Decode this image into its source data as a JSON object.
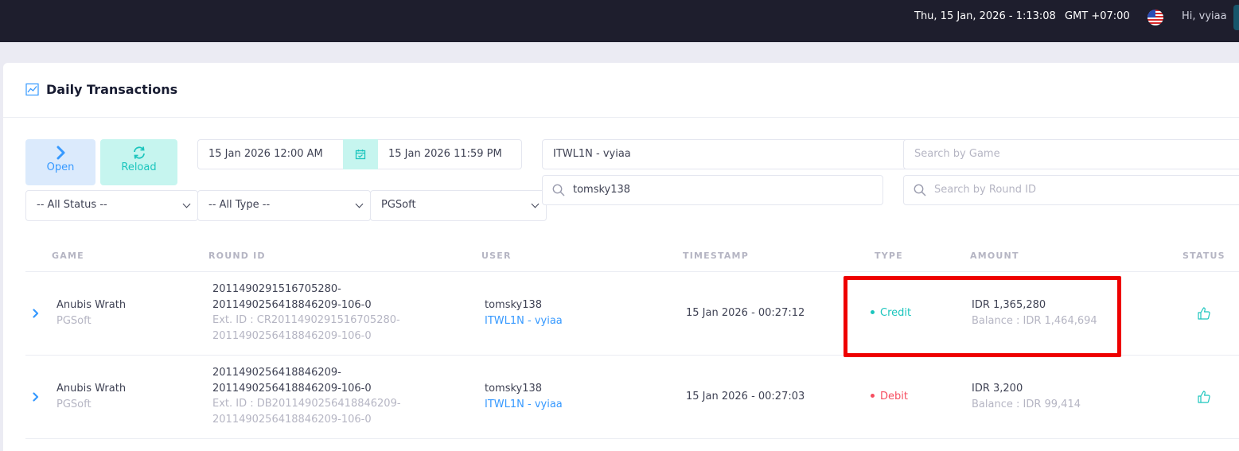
{
  "topbar": {
    "datetime": "Thu, 15 Jan, 2026 - 1:13:08",
    "timezone": "GMT +07:00",
    "greeting": "Hi, vyiaa"
  },
  "page": {
    "title": "Daily Transactions"
  },
  "toolbar": {
    "open_label": "Open",
    "reload_label": "Reload"
  },
  "filters": {
    "date_from": "15 Jan 2026 12:00 AM",
    "date_to": "15 Jan 2026 11:59 PM",
    "agent": "ITWL1N - vyiaa",
    "game_placeholder": "Search by Game",
    "user_value": "tomsky138",
    "round_placeholder": "Search by Round ID",
    "status": "-- All Status --",
    "type": "-- All Type --",
    "provider": "PGSoft"
  },
  "table": {
    "headers": [
      "GAME",
      "ROUND ID",
      "USER",
      "TIMESTAMP",
      "TYPE",
      "AMOUNT",
      "STATUS"
    ],
    "rows": [
      {
        "game": "Anubis Wrath",
        "provider": "PGSoft",
        "round_line1": "2011490291516705280-",
        "round_line2": "2011490256418846209-106-0",
        "ext_line1": "Ext. ID : CR2011490291516705280-",
        "ext_line2": "2011490256418846209-106-0",
        "user": "tomsky138",
        "agent": "ITWL1N - vyiaa",
        "timestamp": "15 Jan 2026 - 00:27:12",
        "type": "Credit",
        "type_color": "#1bc5bd",
        "amount": "IDR 1,365,280",
        "balance": "Balance : IDR 1,464,694"
      },
      {
        "game": "Anubis Wrath",
        "provider": "PGSoft",
        "round_line1": "2011490256418846209-",
        "round_line2": "2011490256418846209-106-0",
        "ext_line1": "Ext. ID : DB2011490256418846209-",
        "ext_line2": "2011490256418846209-106-0",
        "user": "tomsky138",
        "agent": "ITWL1N - vyiaa",
        "timestamp": "15 Jan 2026 - 00:27:03",
        "type": "Debit",
        "type_color": "#f64e60",
        "amount": "IDR 3,200",
        "balance": "Balance : IDR 99,414"
      }
    ]
  },
  "icons": {
    "flag": "us-flag-icon",
    "title": "chart-line-icon",
    "open": "chevron-right-icon",
    "reload": "refresh-icon",
    "calendar": "calendar-icon",
    "search": "search-icon",
    "expand": "chevron-right-icon",
    "status": "thumbs-up-icon"
  },
  "colors": {
    "topbar": "#1e1e2d",
    "primary": "#3699ff",
    "success": "#1bc5bd",
    "danger": "#f64e60",
    "highlight": "#ee0000"
  }
}
